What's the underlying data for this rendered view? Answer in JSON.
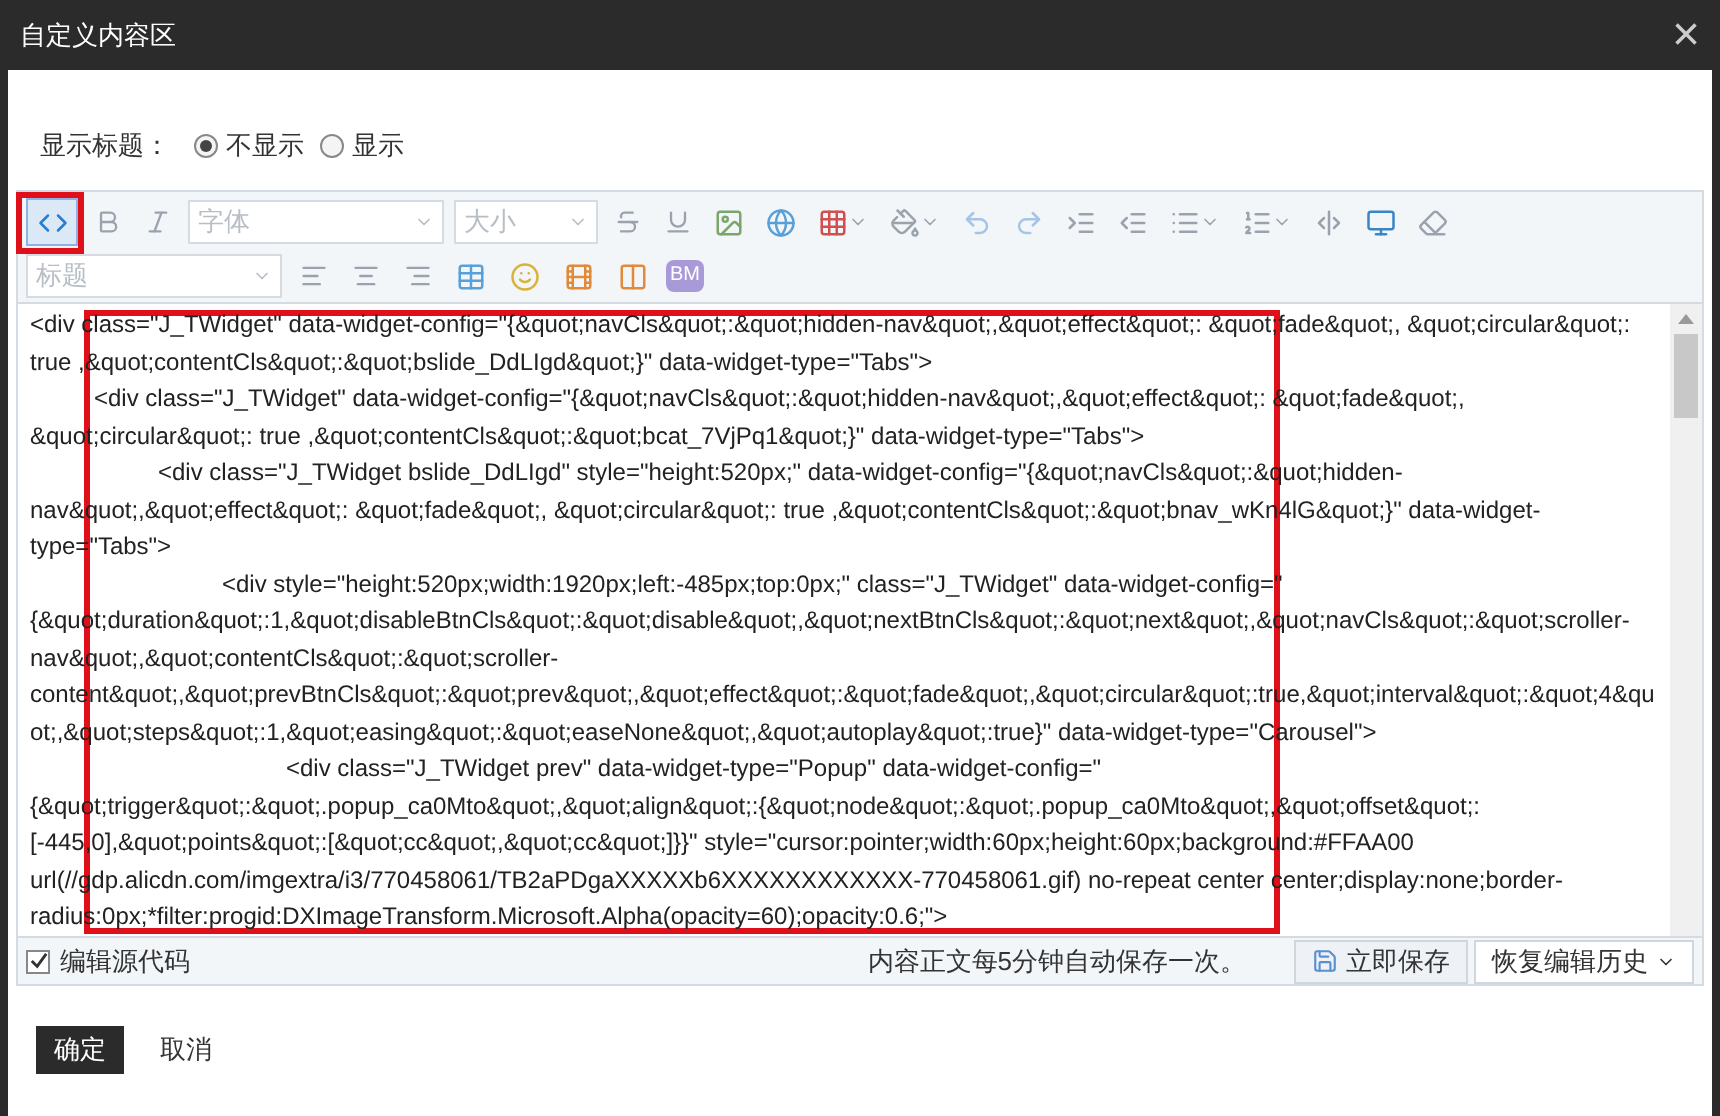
{
  "window": {
    "title": "自定义内容区",
    "close": "×"
  },
  "show_title": {
    "label": "显示标题：",
    "options": [
      {
        "label": "不显示",
        "selected": true
      },
      {
        "label": "显示",
        "selected": false
      }
    ]
  },
  "toolbar": {
    "source_button": {
      "selected": true
    },
    "font_family": "字体",
    "font_size": "大小",
    "heading": "标题",
    "bm": "BM"
  },
  "code": [
    {
      "text": "<div class=\"J_TWidget\" data-widget-config=\"{&quot;navCls&quot;:&quot;hidden-nav&quot;,&quot;effect&quot;: &quot;fade&quot;, &quot;circular&quot;: true ,&quot;contentCls&quot;:&quot;bslide_DdLIgd&quot;}\" data-widget-type=\"Tabs\">",
      "children": [
        {
          "text": "<div class=\"J_TWidget\" data-widget-config=\"{&quot;navCls&quot;:&quot;hidden-nav&quot;,&quot;effect&quot;: &quot;fade&quot;, &quot;circular&quot;: true ,&quot;contentCls&quot;:&quot;bcat_7VjPq1&quot;}\" data-widget-type=\"Tabs\">",
          "children": [
            {
              "text": "<div class=\"J_TWidget bslide_DdLIgd\" style=\"height:520px;\" data-widget-config=\"{&quot;navCls&quot;:&quot;hidden-nav&quot;,&quot;effect&quot;: &quot;fade&quot;, &quot;circular&quot;: true ,&quot;contentCls&quot;:&quot;bnav_wKn4lG&quot;}\" data-widget-type=\"Tabs\">",
              "children": [
                {
                  "text": "<div style=\"height:520px;width:1920px;left:-485px;top:0px;\" class=\"J_TWidget\" data-widget-config=\"{&quot;duration&quot;:1,&quot;disableBtnCls&quot;:&quot;disable&quot;,&quot;nextBtnCls&quot;:&quot;next&quot;,&quot;navCls&quot;:&quot;scroller-nav&quot;,&quot;contentCls&quot;:&quot;scroller-content&quot;,&quot;prevBtnCls&quot;:&quot;prev&quot;,&quot;effect&quot;:&quot;fade&quot;,&quot;circular&quot;:true,&quot;interval&quot;:&quot;4&quot;,&quot;steps&quot;:1,&quot;easing&quot;:&quot;easeNone&quot;,&quot;autoplay&quot;:true}\" data-widget-type=\"Carousel\">",
                  "children": [
                    {
                      "text": "<div class=\"J_TWidget prev\" data-widget-type=\"Popup\" data-widget-config=\"{&quot;trigger&quot;:&quot;.popup_ca0Mto&quot;,&quot;align&quot;:{&quot;node&quot;:&quot;.popup_ca0Mto&quot;,&quot;offset&quot;:[-445,0],&quot;points&quot;:[&quot;cc&quot;,&quot;cc&quot;]}}\" style=\"cursor:pointer;width:60px;height:60px;background:#FFAA00 url(//gdp.alicdn.com/imgextra/i3/770458061/TB2aPDgaXXXXXb6XXXXXXXXXXXX-770458061.gif) no-repeat center center;display:none;border-radius:0px;*filter:progid:DXImageTransform.Microsoft.Alpha(opacity=60);opacity:0.6;\">"
                    }
                  ]
                }
              ]
            }
          ]
        }
      ]
    }
  ],
  "status_bar": {
    "edit_source": {
      "label": "编辑源代码",
      "checked": true
    },
    "autosave_note": "内容正文每5分钟自动保存一次。",
    "save_now": "立即保存",
    "restore_history": "恢复编辑历史"
  },
  "footer": {
    "confirm": "确定",
    "cancel": "取消"
  }
}
